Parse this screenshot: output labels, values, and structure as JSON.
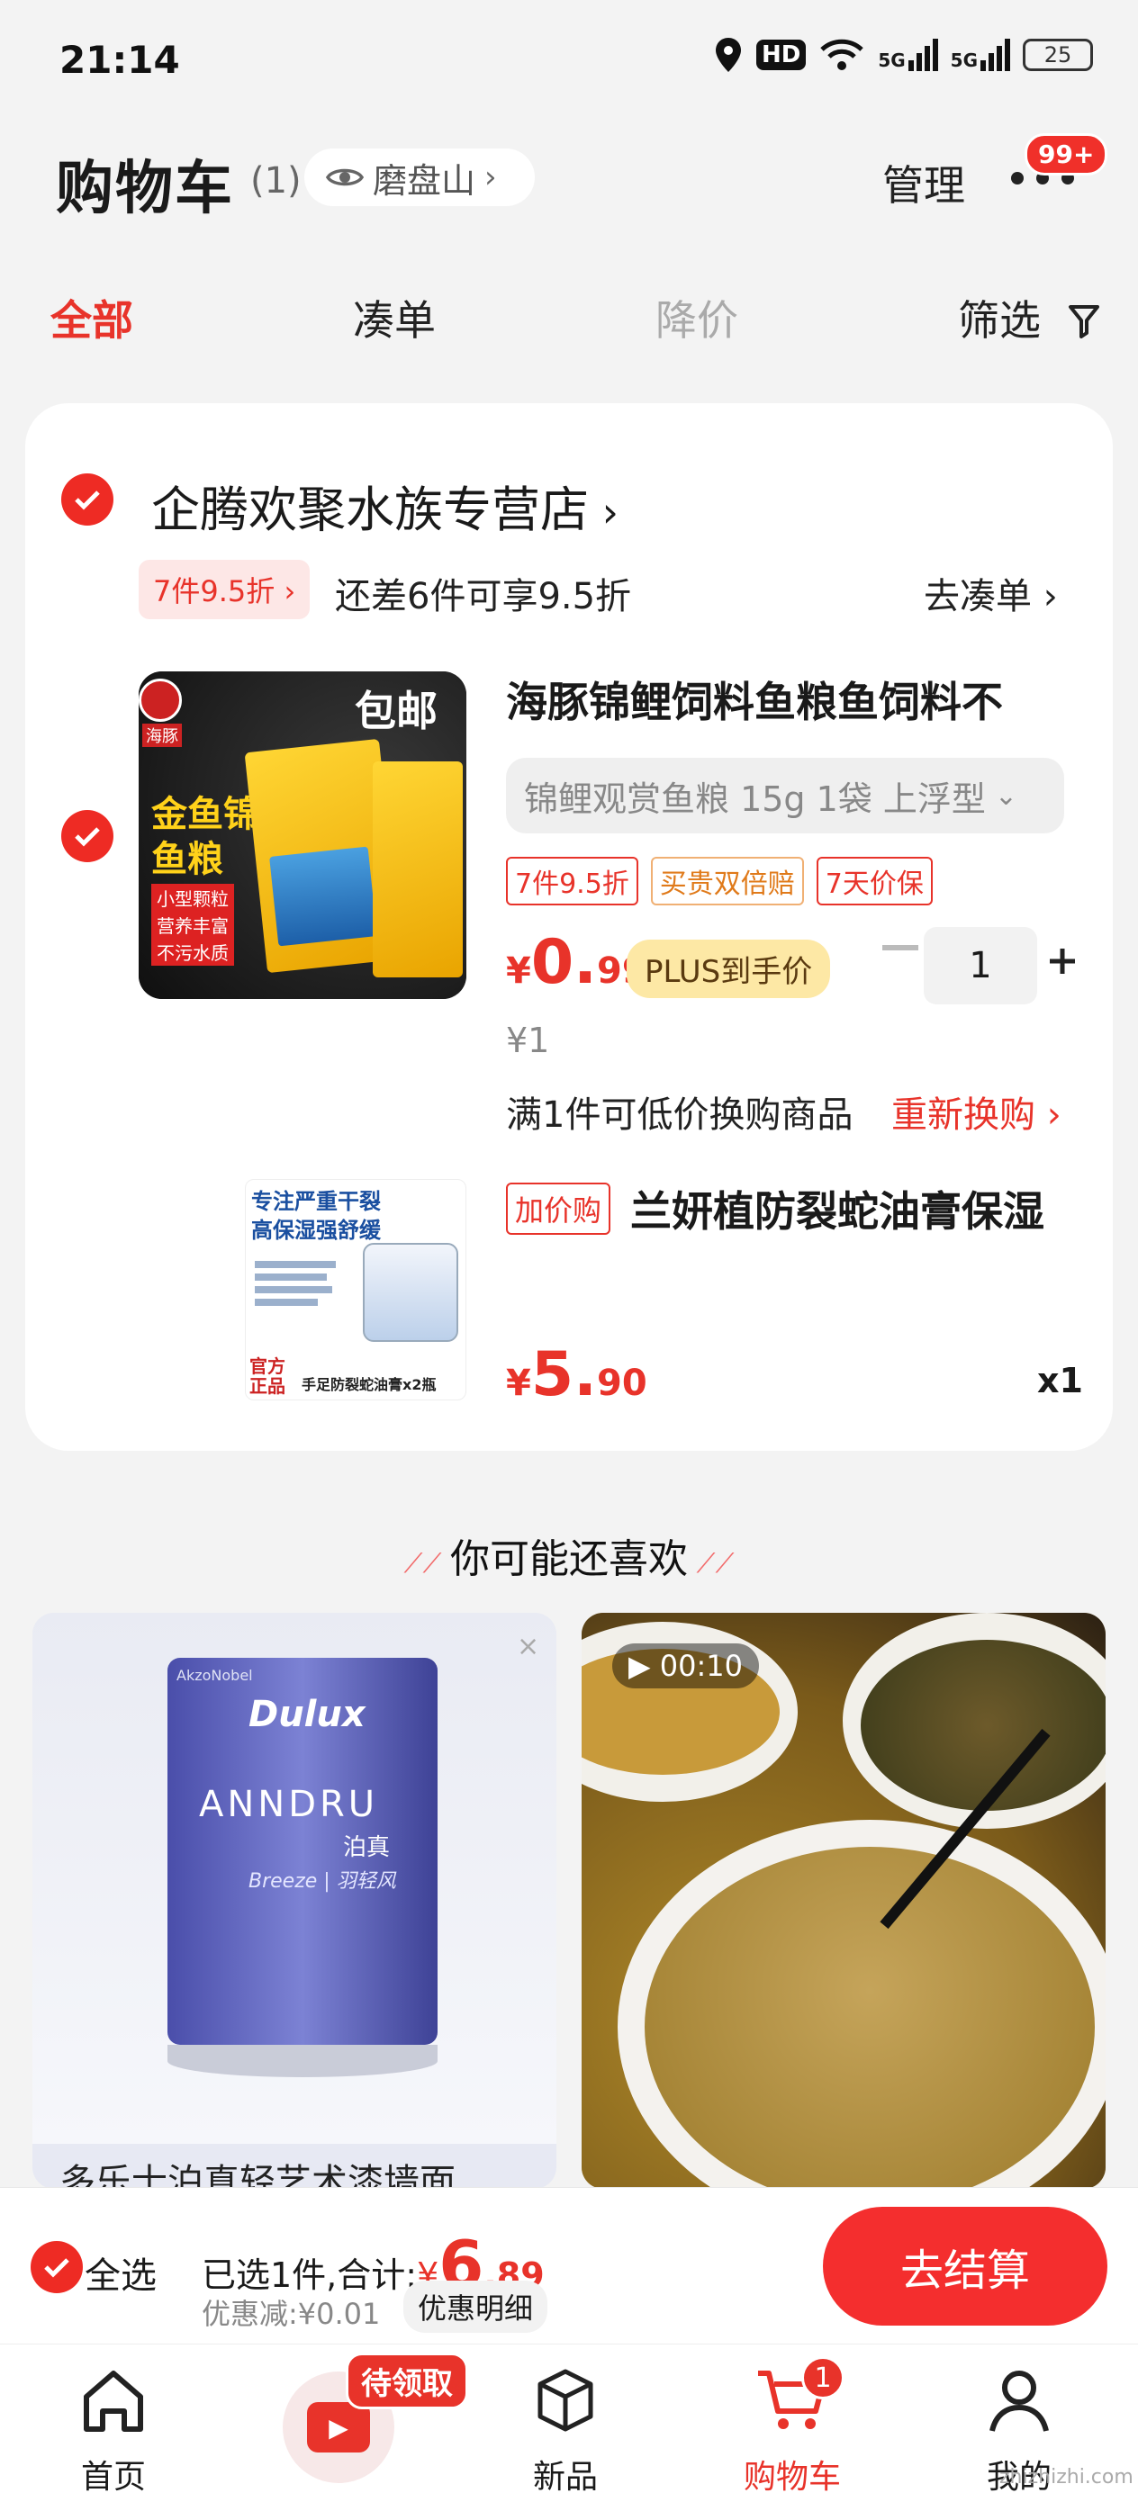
{
  "status_bar": {
    "time": "21:14",
    "hd": "HD",
    "net1": "5G",
    "net2": "5G",
    "battery": "25"
  },
  "header": {
    "title": "购物车",
    "count": "(1)",
    "location": "磨盘山",
    "manage": "管理",
    "badge": "99+"
  },
  "tabs": [
    "全部",
    "凑单",
    "降价",
    "筛选"
  ],
  "store": {
    "name": "企腾欢聚水族专营店",
    "promo_tag": "7件9.5折",
    "promo_text": "还差6件可享9.5折",
    "goto": "去凑单"
  },
  "product1": {
    "title": "海豚锦鲤饲料鱼粮鱼饲料不",
    "sku": "锦鲤观赏鱼粮 15g 1袋 上浮型",
    "tags": [
      "7件9.5折",
      "买贵双倍赔",
      "7天价保"
    ],
    "price_int": "0.",
    "price_dec": "99",
    "currency": "¥",
    "plus_label": "PLUS到手价",
    "qty": "1",
    "orig_price": "¥1",
    "swap_text": "满1件可低价换购商品",
    "reswap": "重新换购",
    "img_texts": {
      "baoyou": "包邮",
      "l1": "金鱼锦鲤",
      "l2": "鱼粮",
      "b1": "小型颗粒",
      "b2": "营养丰富",
      "b3": "不污水质",
      "brand": "海豚"
    }
  },
  "product2": {
    "addbuy": "加价购",
    "title": "兰妍植防裂蛇油膏保湿",
    "price_int": "5.",
    "price_dec": "90",
    "currency": "¥",
    "qty": "x1",
    "img_texts": {
      "t1": "专注严重干裂",
      "t2": "高保湿强舒缓",
      "t3": "官方正品",
      "t4": "手足防裂蛇油膏x2瓶"
    }
  },
  "recommend": {
    "title": "你可能还喜欢",
    "item1_title": "多乐士泊真轻艺术漆墙面",
    "item1_brand": "Dulux",
    "item1_name": "ANNDRU",
    "item1_sub": "泊真",
    "item1_line": "Breeze | 羽轻风",
    "item1_maker": "AkzoNobel",
    "item2_video": "00:10"
  },
  "footer": {
    "select_all": "全选",
    "selected": "已选1件,合计:",
    "currency": "¥",
    "total_int": "6",
    "total_dec": ".89",
    "discount": "优惠减:¥0.01",
    "detail": "优惠明细",
    "checkout": "去结算"
  },
  "nav": {
    "items": [
      "首页",
      "",
      "新品",
      "购物车",
      "我的"
    ],
    "pending": "待领取",
    "cart_badge": "1"
  },
  "watermark": "zhizhizhi.com",
  "colors": {
    "accent": "#e8332a",
    "checkout": "#f42e2e",
    "plus_bg": "#fde8a5"
  }
}
